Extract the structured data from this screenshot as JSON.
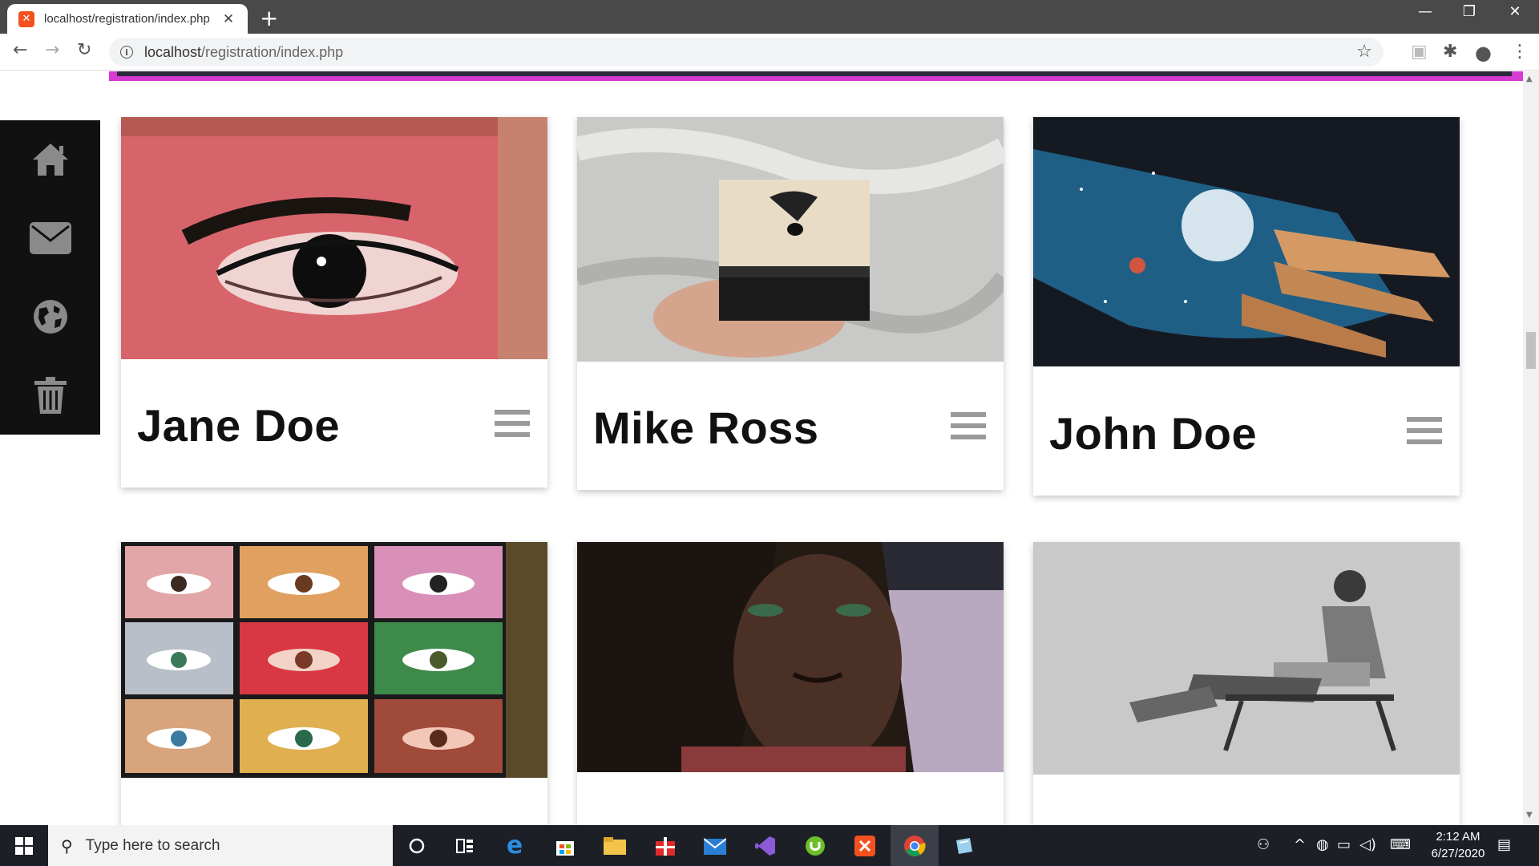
{
  "browser": {
    "tab_title": "localhost/registration/index.php",
    "tab_favicon": "xampp-favicon",
    "new_tab": "+",
    "url_host": "localhost",
    "url_path": "/registration/index.php",
    "window_controls": {
      "minimize": "—",
      "restore": "❐",
      "close": "✕"
    }
  },
  "sidebar": {
    "items": [
      {
        "icon": "home-icon"
      },
      {
        "icon": "envelope-icon"
      },
      {
        "icon": "globe-icon"
      },
      {
        "icon": "trash-icon"
      }
    ]
  },
  "cards": [
    {
      "name": "Jane Doe",
      "image": "red painted eye artwork"
    },
    {
      "name": "Mike Ross",
      "image": "ink drawing held in hand"
    },
    {
      "name": "John Doe",
      "image": "galaxy painted hand"
    },
    {
      "name": "",
      "image": "grid of painted eyes"
    },
    {
      "name": "",
      "image": "portrait painting of woman"
    },
    {
      "name": "",
      "image": "pencil sketch of seated woman"
    }
  ],
  "taskbar": {
    "search_placeholder": "Type here to search",
    "time": "2:12 AM",
    "date": "6/27/2020"
  },
  "colors": {
    "banner": "#d63ad2",
    "sidebar_bg": "#111111",
    "taskbar_bg": "#1c1f26"
  }
}
